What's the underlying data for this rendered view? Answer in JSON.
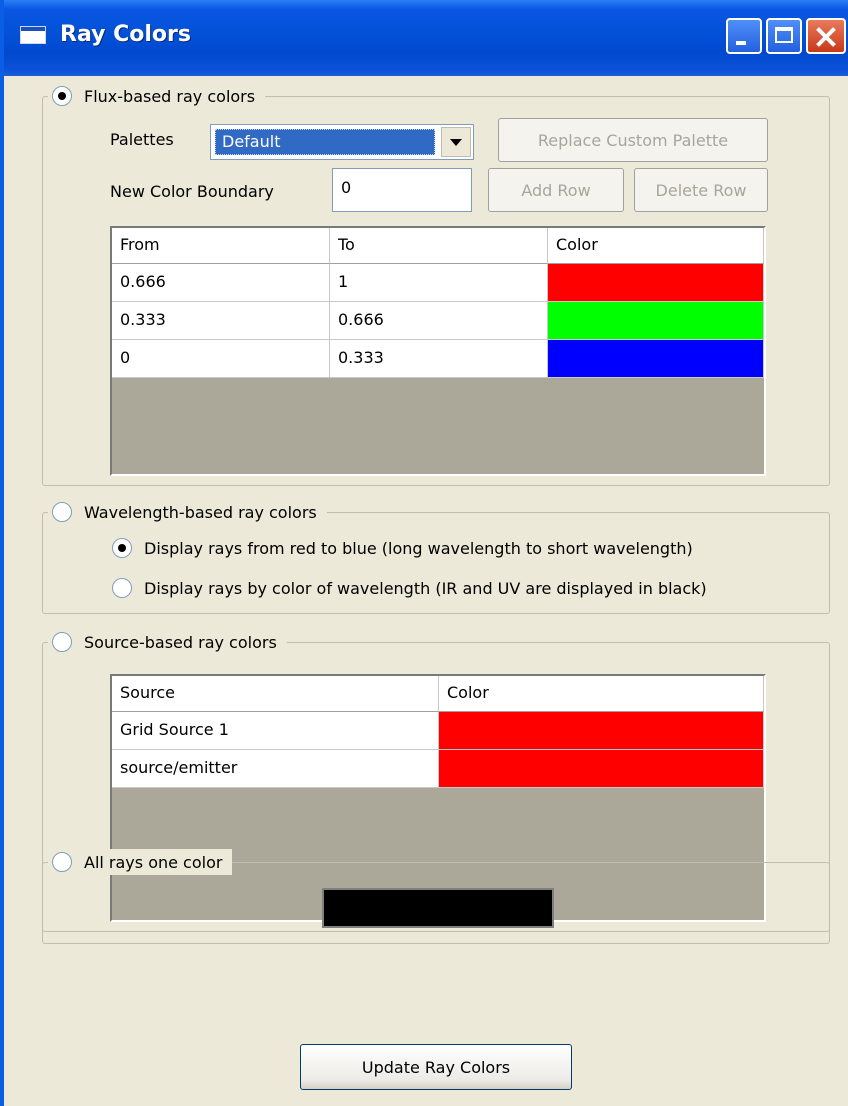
{
  "window": {
    "title": "Ray Colors",
    "title_icon": "window-icon"
  },
  "flux": {
    "label": "Flux-based ray colors",
    "selected": true,
    "palettes_label": "Palettes",
    "palette_value": "Default",
    "replace_button": "Replace Custom Palette",
    "boundary_label": "New Color Boundary",
    "boundary_value": "0",
    "add_row_button": "Add Row",
    "delete_row_button": "Delete Row",
    "columns": [
      "From",
      "To",
      "Color"
    ],
    "rows": [
      {
        "from": "0.666",
        "to": "1",
        "color": "#ff0000"
      },
      {
        "from": "0.333",
        "to": "0.666",
        "color": "#00ff00"
      },
      {
        "from": "0",
        "to": "0.333",
        "color": "#0000ff"
      }
    ]
  },
  "wavelength": {
    "label": "Wavelength-based ray colors",
    "selected": false,
    "option_red_blue": "Display rays from red to blue (long wavelength to short wavelength)",
    "option_red_blue_selected": true,
    "option_by_color": "Display rays by color of wavelength (IR and UV are displayed in black)",
    "option_by_color_selected": false
  },
  "source": {
    "label": "Source-based ray colors",
    "selected": false,
    "columns": [
      "Source",
      "Color"
    ],
    "rows": [
      {
        "source": "Grid Source 1",
        "color": "#ff0000"
      },
      {
        "source": "source/emitter",
        "color": "#ff0000"
      }
    ]
  },
  "single": {
    "label": "All rays one color",
    "selected": false,
    "color": "#000000"
  },
  "update_button": "Update Ray Colors",
  "colors": {
    "titlebar": "#0a56e3",
    "window_bg": "#ece9d8",
    "selection": "#316ac5"
  }
}
